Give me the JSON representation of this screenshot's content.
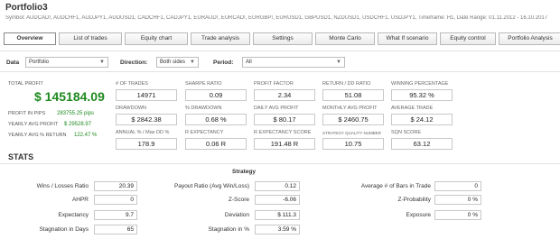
{
  "window": {
    "title": "Portfolio3",
    "symbols_line": "Symbol: AUDCAD!, AUDCHF1, AUDJPY1, AUDUSD1, CADCHF1, CADJPY1, EURAUD!, EURCAD!, EURGBP!, EURUSD1, GBPUSD1, NZDUSD1, USDCHF1, USDJPY1, Timeframe: H1, Date Range: 01.11.2012 - 16.10.2017"
  },
  "tabs": [
    "Overview",
    "List of trades",
    "Equity chart",
    "Trade analysis",
    "Settings",
    "Monte Carlo",
    "What If scenario",
    "Equity control",
    "Portfolio Analysis"
  ],
  "filters": {
    "data_label": "Data",
    "data_value": "Portfolio",
    "direction_label": "Direction:",
    "direction_value": "Both sides",
    "period_label": "Period:",
    "period_value": "All",
    "arrow": "▼"
  },
  "summary": {
    "total_profit_label": "TOTAL PROFIT",
    "total_profit": "$ 145184.09",
    "profit_pips_label": "PROFIT IN PIPS",
    "profit_pips": "283755.25 pips",
    "yearly_avg_profit_label": "YEARLY AVG PROFIT",
    "yearly_avg_profit": "$ 29528.97",
    "yearly_avg_return_label": "YEARLY AVG % RETURN",
    "yearly_avg_return": "122.47 %"
  },
  "metrics": [
    {
      "label": "# OF TRADES",
      "value": "14971"
    },
    {
      "label": "SHARPE RATIO",
      "value": "0.09"
    },
    {
      "label": "PROFIT FACTOR",
      "value": "2.34"
    },
    {
      "label": "RETURN / DD RATIO",
      "value": "51.08"
    },
    {
      "label": "WINNING PERCENTAGE",
      "value": "95.32 %"
    },
    {
      "label": "DRAWDOWN",
      "value": "$ 2842.38"
    },
    {
      "label": "% DRAWDOWN",
      "value": "0.68 %"
    },
    {
      "label": "DAILY AVG PROFIT",
      "value": "$ 80.17"
    },
    {
      "label": "MONTHLY AVG PROFIT",
      "value": "$ 2460.75"
    },
    {
      "label": "AVERAGE TRADE",
      "value": "$ 24.12"
    },
    {
      "label": "ANNUAL % / Max DD %",
      "value": "178.9"
    },
    {
      "label": "R EXPECTANCY",
      "value": "0.06 R"
    },
    {
      "label": "R EXPECTANCY SCORE",
      "value": "191.48 R"
    },
    {
      "label": "STRATEGY QUALITY NUMBER",
      "value": "10.75"
    },
    {
      "label": "SQN SCORE",
      "value": "63.12"
    }
  ],
  "stats": {
    "title": "STATS",
    "section": "Strategy",
    "rows": [
      {
        "label": "Wins / Losses Ratio",
        "value": "20.39"
      },
      {
        "label": "AHPR",
        "value": "0"
      },
      {
        "label": "Expectancy",
        "value": "9.7"
      },
      {
        "label": "Stagnation in Days",
        "value": "65"
      },
      {
        "label": "Payout Ratio (Avg Win/Loss)",
        "value": "0.12"
      },
      {
        "label": "Z-Score",
        "value": "-6.06"
      },
      {
        "label": "Deviation",
        "value": "$ 111.3"
      },
      {
        "label": "Stagnation in %",
        "value": "3.59 %"
      },
      {
        "label": "Average # of Bars in Trade",
        "value": "0"
      },
      {
        "label": "Z-Probability",
        "value": "0 %"
      },
      {
        "label": "Exposure",
        "value": "0 %"
      }
    ]
  }
}
